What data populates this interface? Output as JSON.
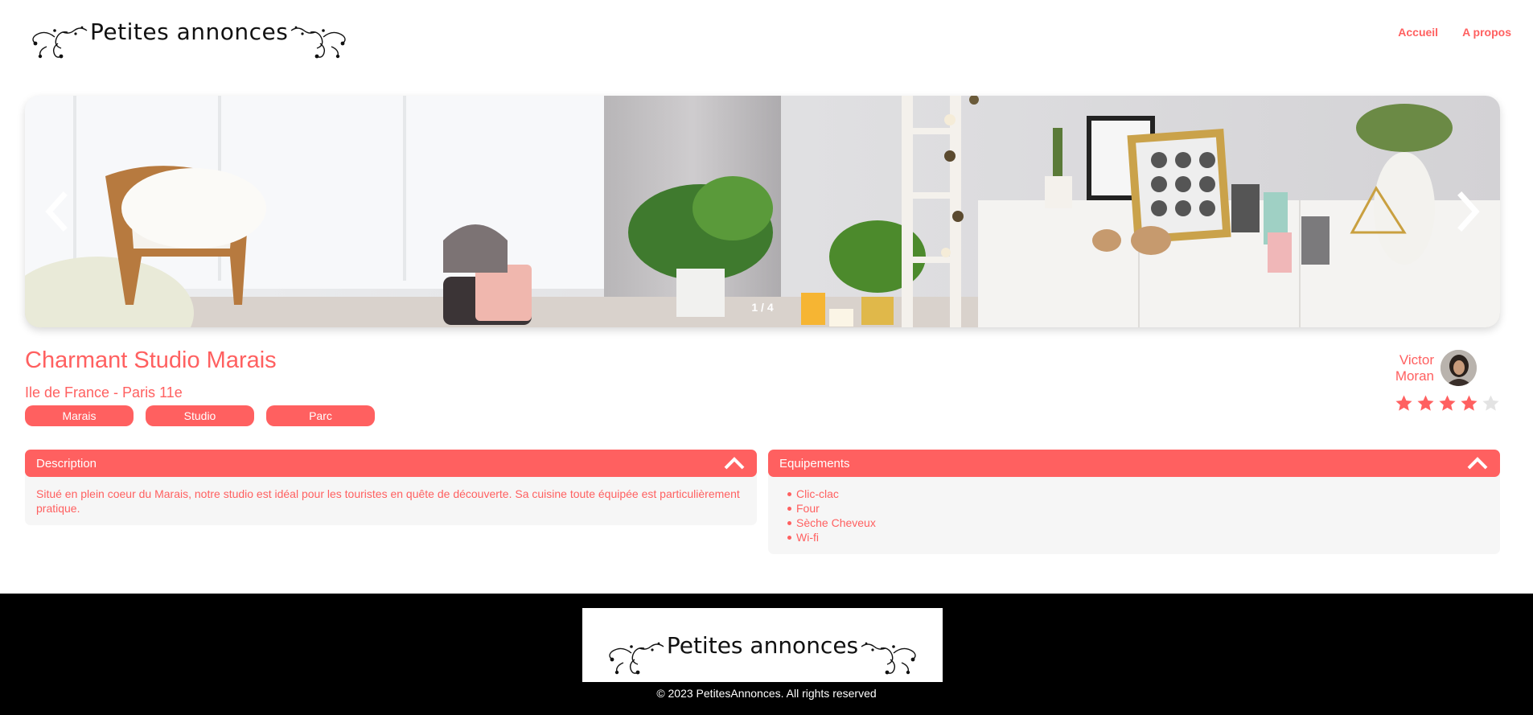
{
  "brand": {
    "name": "Petites annonces"
  },
  "nav": {
    "home": "Accueil",
    "about": "A propos"
  },
  "carousel": {
    "counter": "1 / 4"
  },
  "listing": {
    "title": "Charmant Studio Marais",
    "location": "Ile de France - Paris 11e",
    "tags": [
      "Marais",
      "Studio",
      "Parc"
    ],
    "host": {
      "first_name": "Victor",
      "last_name": "Moran"
    },
    "rating": 4,
    "rating_max": 5
  },
  "description": {
    "header": "Description",
    "text": "Situé en plein coeur du Marais, notre studio est idéal pour les touristes en quête de découverte. Sa cuisine toute équipée est particulièrement pratique."
  },
  "equipments": {
    "header": "Equipements",
    "items": [
      "Clic-clac",
      "Four",
      "Sèche Cheveux",
      "Wi-fi"
    ]
  },
  "footer": {
    "copyright": "© 2023 PetitesAnnonces. All rights reserved"
  },
  "colors": {
    "accent": "#ff6060",
    "panel": "#f6f6f6",
    "footer_bg": "#000000"
  }
}
